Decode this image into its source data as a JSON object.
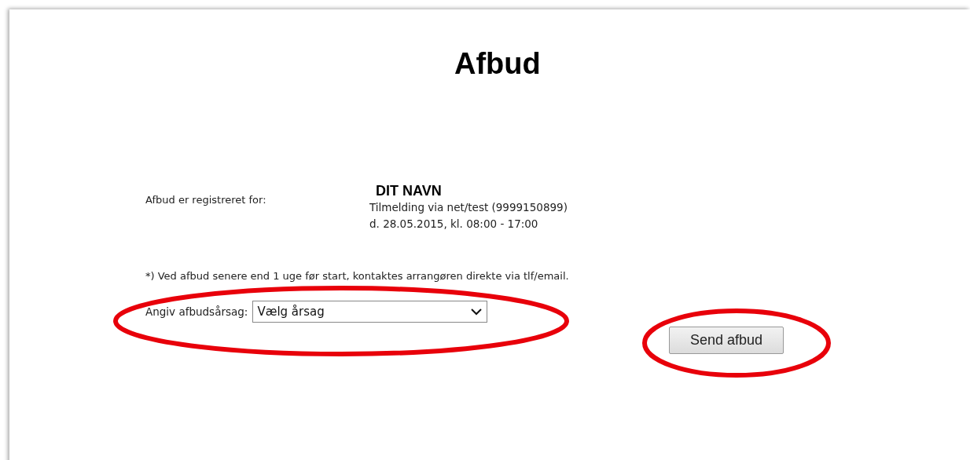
{
  "title": "Afbud",
  "registration": {
    "label": "Afbud er registreret for:",
    "name": "DIT NAVN",
    "event": "Tilmelding via net/test (9999150899)",
    "date": "d. 28.05.2015, kl. 08:00 - 17:00"
  },
  "note": "*) Ved afbud senere end 1 uge før start, kontaktes arrangøren direkte via tlf/email.",
  "reason": {
    "label": "Angiv afbudsårsag:",
    "value": "Vælg årsag"
  },
  "submit": "Send afbud"
}
